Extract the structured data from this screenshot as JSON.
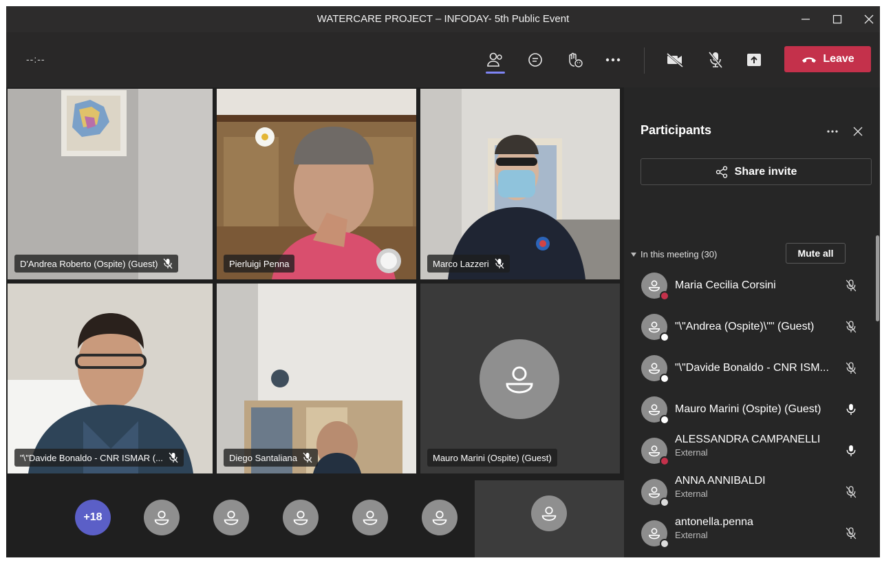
{
  "window": {
    "title": "WATERCARE PROJECT – INFODAY- 5th Public Event"
  },
  "toolbar": {
    "timer": "--:--",
    "leave_label": "Leave"
  },
  "tiles": [
    {
      "name": "D'Andrea Roberto (Ospite) (Guest)",
      "muted": true
    },
    {
      "name": "Pierluigi Penna",
      "muted": false
    },
    {
      "name": "Marco Lazzeri",
      "muted": true
    },
    {
      "name": "\"\\\"Davide Bonaldo - CNR ISMAR (...",
      "muted": true
    },
    {
      "name": "Diego Santaliana",
      "muted": true
    },
    {
      "name": "Mauro Marini (Ospite) (Guest)",
      "muted": false
    }
  ],
  "strip": {
    "more_count": "+18"
  },
  "panel": {
    "title": "Participants",
    "share_label": "Share invite",
    "section_label": "In this meeting (30)",
    "mute_all_label": "Mute all",
    "participants": [
      {
        "name": "Maria Cecilia Corsini",
        "sub": "",
        "status": "busy",
        "mic": "muted"
      },
      {
        "name": "\"\\\"Andrea (Ospite)\\\"\" (Guest)",
        "sub": "",
        "status": "offline",
        "mic": "muted"
      },
      {
        "name": "\"\\\"Davide Bonaldo - CNR ISM...",
        "sub": "",
        "status": "offline",
        "mic": "muted"
      },
      {
        "name": "Mauro Marini (Ospite) (Guest)",
        "sub": "",
        "status": "offline",
        "mic": "on"
      },
      {
        "name": "ALESSANDRA CAMPANELLI",
        "sub": "External",
        "status": "busy",
        "mic": "on"
      },
      {
        "name": "ANNA ANNIBALDI",
        "sub": "External",
        "status": "unknown",
        "mic": "muted"
      },
      {
        "name": "antonella.penna",
        "sub": "External",
        "status": "unknown",
        "mic": "muted"
      }
    ]
  },
  "colors": {
    "leave": "#c4314b",
    "accent": "#7f85f5",
    "more_badge": "#5b5fc7",
    "busy": "#c4314b"
  }
}
